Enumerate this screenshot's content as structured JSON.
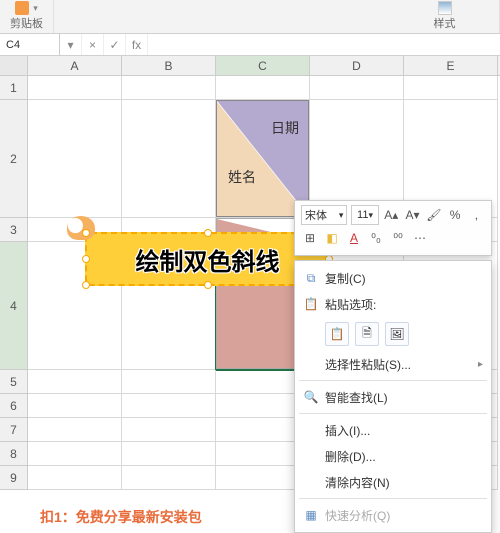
{
  "ribbon": {
    "clipboard_label": "剪贴板",
    "styles_label": "样式"
  },
  "formula_bar": {
    "name_box": "C4",
    "btn_dropdown": "▾",
    "btn_cancel": "×",
    "btn_confirm": "✓",
    "fx_label": "fx"
  },
  "columns": [
    "A",
    "B",
    "C",
    "D",
    "E"
  ],
  "rows": [
    "1",
    "2",
    "3",
    "4",
    "5",
    "6",
    "7",
    "8",
    "9"
  ],
  "cell_c2": {
    "top_label": "日期",
    "bottom_label": "姓名"
  },
  "banner_text": "绘制双色斜线",
  "mini_toolbar": {
    "font_name": "宋体",
    "font_size": "11",
    "inc_font": "A▴",
    "dec_font": "A▾",
    "format_painter": "🖌",
    "percent": "%",
    "comma": ",",
    "border": "⊞",
    "fill": "◧",
    "font_color": "A",
    "decimals_dec": "⁰₀",
    "decimals_inc": "⁰⁰",
    "more": "⋯"
  },
  "context_menu": {
    "copy": "复制(C)",
    "paste_options_label": "粘贴选项:",
    "paste_special": "选择性粘贴(S)...",
    "smart_lookup": "智能查找(L)",
    "insert": "插入(I)...",
    "delete": "删除(D)...",
    "clear": "清除内容(N)",
    "quick_analysis": "快速分析(Q)"
  },
  "promo_text": "扣1：免费分享最新安装包"
}
